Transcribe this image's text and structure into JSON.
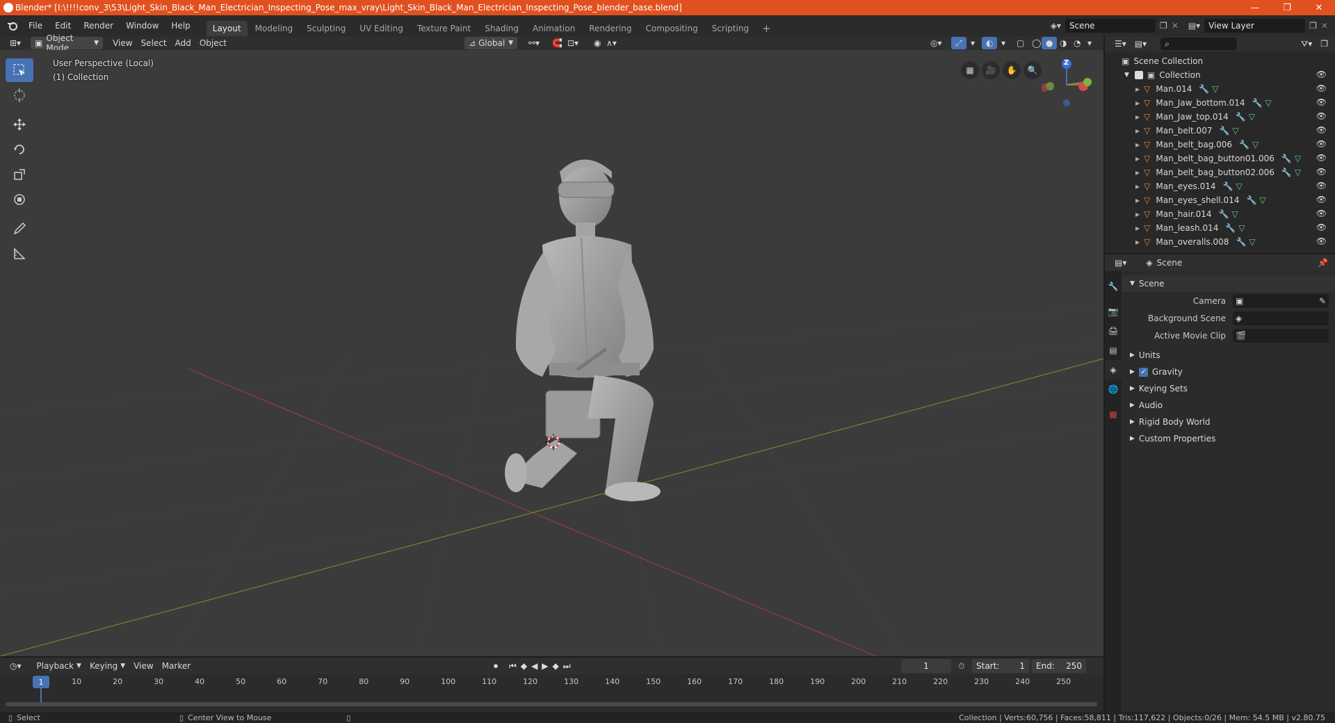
{
  "window": {
    "title": "Blender* [I:\\!!!!conv_3\\53\\Light_Skin_Black_Man_Electrician_Inspecting_Pose_max_vray\\Light_Skin_Black_Man_Electrician_Inspecting_Pose_blender_base.blend]",
    "minimize": "—",
    "restore": "❐",
    "close": "✕"
  },
  "menu": {
    "items": [
      "File",
      "Edit",
      "Render",
      "Window",
      "Help"
    ]
  },
  "workspaces": [
    "Layout",
    "Modeling",
    "Sculpting",
    "UV Editing",
    "Texture Paint",
    "Shading",
    "Animation",
    "Rendering",
    "Compositing",
    "Scripting"
  ],
  "workspace_active": "Layout",
  "add_workspace": "+",
  "scene_field": "Scene",
  "view_layer_field": "View Layer",
  "viewport_header": {
    "mode": "Object Mode",
    "menus": [
      "View",
      "Select",
      "Add",
      "Object"
    ],
    "orientation": "Global"
  },
  "viewport": {
    "perspective": "User Perspective (Local)",
    "collection": "(1) Collection",
    "gizmo_z": "Z"
  },
  "outliner": {
    "root": "Scene Collection",
    "collection": "Collection",
    "objects": [
      "Man.014",
      "Man_Jaw_bottom.014",
      "Man_Jaw_top.014",
      "Man_belt.007",
      "Man_belt_bag.006",
      "Man_belt_bag_button01.006",
      "Man_belt_bag_button02.006",
      "Man_eyes.014",
      "Man_eyes_shell.014",
      "Man_hair.014",
      "Man_leash.014",
      "Man_overalls.008"
    ]
  },
  "properties": {
    "header": "Scene",
    "section": "Scene",
    "camera_label": "Camera",
    "bg_scene_label": "Background Scene",
    "movie_clip_label": "Active Movie Clip",
    "subsections": [
      "Units",
      "Gravity",
      "Keying Sets",
      "Audio",
      "Rigid Body World",
      "Custom Properties"
    ],
    "gravity_checked": true
  },
  "timeline": {
    "menus": [
      "Playback",
      "Keying",
      "View",
      "Marker"
    ],
    "current_frame": "1",
    "start_label": "Start:",
    "start": "1",
    "end_label": "End:",
    "end": "250",
    "ruler": [
      "1",
      "10",
      "20",
      "30",
      "40",
      "50",
      "60",
      "70",
      "80",
      "90",
      "100",
      "110",
      "120",
      "130",
      "140",
      "150",
      "160",
      "170",
      "180",
      "190",
      "200",
      "210",
      "220",
      "230",
      "240",
      "250"
    ]
  },
  "status": {
    "select": "Select",
    "center_view": "Center View to Mouse",
    "stats": "Collection | Verts:60,756 | Faces:58,811 | Tris:117,622 | Objects:0/26 | Mem: 54.5 MB | v2.80.75"
  },
  "colors": {
    "accent": "#4772b3",
    "title_bar": "#e1501f",
    "object_orange": "#e88a35",
    "mesh_green": "#5fcf8a"
  }
}
